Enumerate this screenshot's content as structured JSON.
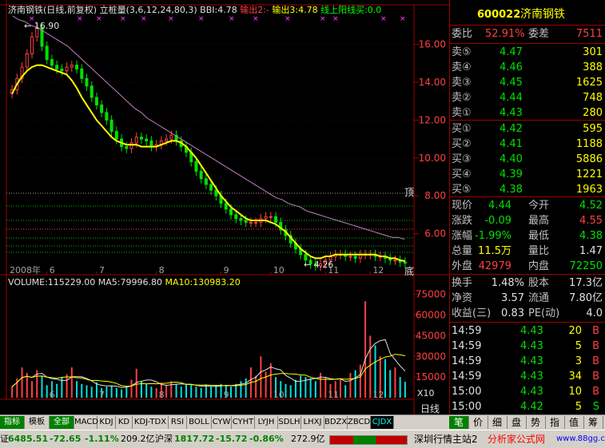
{
  "header": {
    "stock_title": "济南钢铁(日线,前复权)",
    "indicator": "立桩量(3,6,12,24,80,3)",
    "bbi": "BBI:4.78",
    "out2": "输出2:-",
    "out3": "输出3:4.78",
    "buy_line": "线上阳线买:0.0"
  },
  "vol_header": {
    "volume": "VOLUME:115229.00",
    "ma5": "MA5:79996.80",
    "ma10": "MA10:130983.20"
  },
  "labels": {
    "max_price": "16.90",
    "min_price": "4.26",
    "top_mark": "顶",
    "bottom_mark": "底",
    "scale_unit": "X10",
    "period": "日线"
  },
  "colors": {
    "up": "#ff4040",
    "down": "#00e000",
    "ma_yellow": "#ffff00",
    "ma_purple": "#c080c0",
    "axis": "#a00000"
  },
  "chart_data": {
    "type": "candlestick",
    "x_year_label": "2008年",
    "x_month_labels": [
      "6",
      "7",
      "8",
      "9",
      "10",
      "11",
      "12"
    ],
    "price_ylim": [
      4.0,
      17.5
    ],
    "price_ticks": [
      6.0,
      8.0,
      10.0,
      12.0,
      14.0,
      16.0
    ],
    "price_tick_labels": [
      "6.00",
      "8.00",
      "10.00",
      "12.00",
      "14.00",
      "16.00"
    ],
    "price_series": {
      "close": [
        13.6,
        14.2,
        14.8,
        15.5,
        16.4,
        16.9,
        15.9,
        15.2,
        14.9,
        14.7,
        14.6,
        14.8,
        14.9,
        14.7,
        14.2,
        13.8,
        13.2,
        12.8,
        12.4,
        12.0,
        11.4,
        11.0,
        10.6,
        10.5,
        10.8,
        11.1,
        11.0,
        10.9,
        10.6,
        10.7,
        10.9,
        11.0,
        11.2,
        10.9,
        10.6,
        10.3,
        9.8,
        9.3,
        8.9,
        8.6,
        8.3,
        8.0,
        7.6,
        7.3,
        7.0,
        6.8,
        6.7,
        6.6,
        6.6,
        6.6,
        6.8,
        6.9,
        6.9,
        6.6,
        6.2,
        5.9,
        5.5,
        5.2,
        4.9,
        4.6,
        4.4,
        4.3,
        4.4,
        4.6,
        4.8,
        4.9,
        4.9,
        4.8,
        4.8,
        4.7,
        4.9,
        4.9,
        4.9,
        4.8,
        4.8,
        4.7,
        4.6,
        4.6,
        4.5,
        4.44
      ],
      "ma": [
        13.4,
        13.9,
        14.3,
        14.6,
        14.8,
        14.9,
        14.9,
        14.8,
        14.7,
        14.6,
        14.5,
        14.4,
        14.1,
        13.7,
        13.2,
        12.8,
        12.4,
        12.0,
        11.7,
        11.4,
        11.1,
        10.9,
        10.8,
        10.7,
        10.7,
        10.7,
        10.6,
        10.6,
        10.6,
        10.6,
        10.7,
        10.8,
        10.9,
        10.9,
        10.8,
        10.6,
        10.3,
        10.0,
        9.6,
        9.2,
        8.8,
        8.4,
        8.0,
        7.7,
        7.4,
        7.2,
        7.0,
        6.8,
        6.7,
        6.7,
        6.7,
        6.7,
        6.6,
        6.5,
        6.3,
        6.1,
        5.8,
        5.5,
        5.2,
        5.0,
        4.8,
        4.7,
        4.7,
        4.8,
        4.8,
        4.9,
        4.9,
        4.9,
        4.9,
        4.9,
        4.9,
        4.9,
        4.9,
        4.9,
        4.8,
        4.8,
        4.7,
        4.7,
        4.6,
        4.55
      ],
      "long_ma": [
        17.5,
        17.3,
        17.2,
        17.0,
        16.9,
        16.7,
        16.5,
        16.3,
        16.1,
        15.9,
        15.6,
        15.3,
        15.0,
        14.7,
        14.4,
        14.1,
        13.8,
        13.5,
        13.2,
        12.9,
        12.6,
        12.4,
        12.1,
        11.9,
        11.7,
        11.5,
        11.3,
        11.1,
        10.9,
        10.7,
        10.5,
        10.3,
        10.1,
        9.9,
        9.7,
        9.5,
        9.3,
        9.1,
        8.9,
        8.7,
        8.5,
        8.3,
        8.1,
        7.9,
        7.8,
        7.6,
        7.5,
        7.4,
        7.2,
        7.1,
        7.0,
        6.9,
        6.8,
        6.7,
        6.6,
        6.5,
        6.4,
        6.3,
        6.2,
        6.1,
        6.0,
        5.9,
        5.8,
        5.8,
        5.7
      ]
    },
    "volume_ylim": [
      0,
      80000
    ],
    "volume_ticks": [
      15000,
      30000,
      45000,
      60000,
      75000
    ],
    "volume_tick_labels": [
      "15000",
      "30000",
      "45000",
      "60000",
      "75000"
    ],
    "volume": [
      8000,
      14000,
      22000,
      18000,
      12000,
      20000,
      16000,
      9000,
      12000,
      10000,
      15000,
      17000,
      22000,
      12000,
      10000,
      9000,
      8000,
      11000,
      7000,
      8000,
      9000,
      7000,
      6000,
      8000,
      13000,
      21000,
      12000,
      10000,
      8000,
      7000,
      11000,
      9000,
      12000,
      10000,
      8000,
      10000,
      9000,
      8000,
      7000,
      9000,
      8000,
      9000,
      10000,
      9000,
      8000,
      10000,
      12000,
      14000,
      22000,
      16000,
      30000,
      19000,
      25000,
      15000,
      12000,
      10000,
      9000,
      13000,
      16000,
      15000,
      14000,
      12000,
      18000,
      15000,
      10000,
      12000,
      13000,
      9000,
      18000,
      20000,
      24000,
      70000,
      45000,
      38000,
      30000,
      28000,
      20000,
      22000,
      15000,
      11500
    ]
  },
  "quote": {
    "code": "600022",
    "name": "济南钢铁",
    "weibi_label": "委比",
    "weibi_val": "52.91%",
    "weicha_label": "委差",
    "weicha_val": "7511",
    "sell": [
      {
        "label": "卖⑤",
        "price": "4.47",
        "vol": "301"
      },
      {
        "label": "卖④",
        "price": "4.46",
        "vol": "388"
      },
      {
        "label": "卖③",
        "price": "4.45",
        "vol": "1625"
      },
      {
        "label": "卖②",
        "price": "4.44",
        "vol": "748"
      },
      {
        "label": "卖①",
        "price": "4.43",
        "vol": "280"
      }
    ],
    "buy": [
      {
        "label": "买①",
        "price": "4.42",
        "vol": "595"
      },
      {
        "label": "买②",
        "price": "4.41",
        "vol": "1188"
      },
      {
        "label": "买③",
        "price": "4.40",
        "vol": "5886"
      },
      {
        "label": "买④",
        "price": "4.39",
        "vol": "1221"
      },
      {
        "label": "买⑤",
        "price": "4.38",
        "vol": "1963"
      }
    ],
    "stats": [
      {
        "l1": "现价",
        "v1": "4.44",
        "c1": "dn",
        "l2": "今开",
        "v2": "4.52",
        "c2": "dn"
      },
      {
        "l1": "涨跌",
        "v1": "-0.09",
        "c1": "dn",
        "l2": "最高",
        "v2": "4.55",
        "c2": "up"
      },
      {
        "l1": "涨幅",
        "v1": "-1.99%",
        "c1": "dn",
        "l2": "最低",
        "v2": "4.38",
        "c2": "dn"
      },
      {
        "l1": "总量",
        "v1": "11.5万",
        "c1": "yl",
        "l2": "量比",
        "v2": "1.47",
        "c2": "wh"
      },
      {
        "l1": "外盘",
        "v1": "42979",
        "c1": "up",
        "l2": "内盘",
        "v2": "72250",
        "c2": "dn"
      }
    ],
    "fin": [
      {
        "l1": "换手",
        "v1": "1.48%",
        "l2": "股本",
        "v2": "17.3亿"
      },
      {
        "l1": "净资",
        "v1": "3.57",
        "l2": "流通",
        "v2": "7.80亿"
      },
      {
        "l1": "收益(三)",
        "v1": "0.83",
        "l2": "PE(动)",
        "v2": "4.0"
      }
    ],
    "ticks": [
      {
        "time": "14:59",
        "price": "4.43",
        "vol": "20",
        "side": "B"
      },
      {
        "time": "14:59",
        "price": "4.43",
        "vol": "5",
        "side": "B"
      },
      {
        "time": "14:59",
        "price": "4.43",
        "vol": "3",
        "side": "B"
      },
      {
        "time": "14:59",
        "price": "4.43",
        "vol": "34",
        "side": "B"
      },
      {
        "time": "15:00",
        "price": "4.43",
        "vol": "10",
        "side": "B"
      },
      {
        "time": "15:00",
        "price": "4.42",
        "vol": "5",
        "side": "S"
      }
    ]
  },
  "tabs": [
    "指标",
    "模板",
    "全部",
    "MACD",
    "KDJ",
    "KD",
    "KDJ-TDX",
    "RSI",
    "BOLL",
    "CYW",
    "CYHT",
    "LYJH",
    "SDLH",
    "LHXJ",
    "BDZX",
    "ZBCD",
    "CJDX"
  ],
  "right_tabs": [
    "笔",
    "价",
    "细",
    "盘",
    "势",
    "指",
    "值",
    "筹"
  ],
  "status": {
    "sh_val": "6485.51",
    "sh_chg": "-72.65",
    "sh_pct": "-1.11%",
    "sh_amt": "209.2亿",
    "sz_label": "沪深",
    "sz_val": "1817.72",
    "sz_chg": "-15.72",
    "sz_pct": "-0.86%",
    "sz_amt": "272.9亿",
    "server": "深圳行情主站2",
    "site": "分析家公式网",
    "url": "www.88gg.com"
  }
}
